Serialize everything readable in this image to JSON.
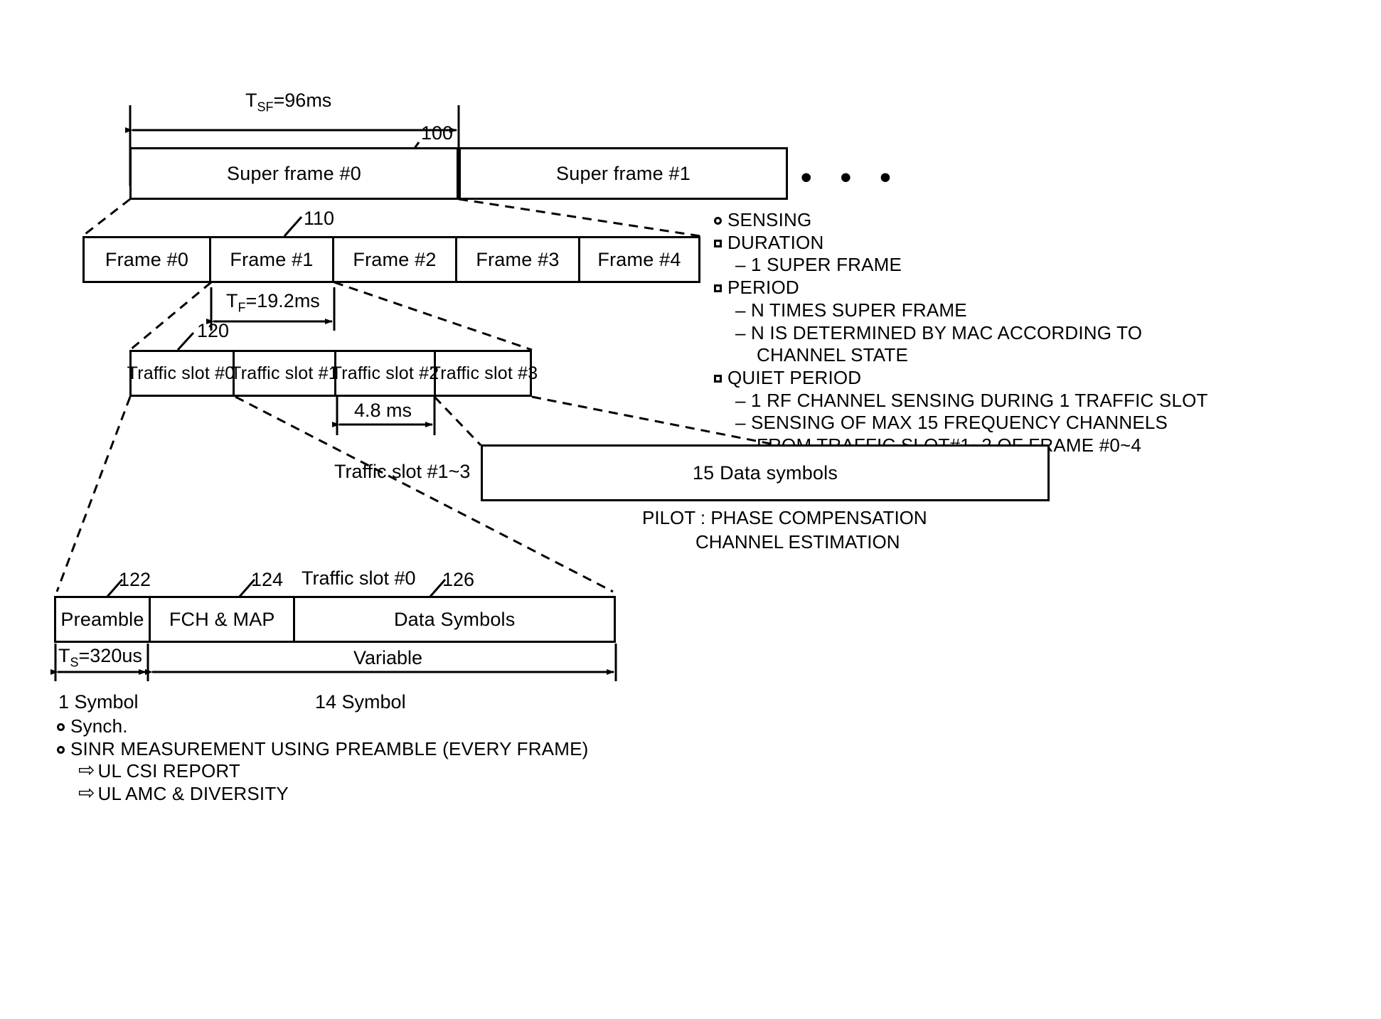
{
  "diagram": {
    "superframe": {
      "duration_label": "T_SF=96ms",
      "duration_main": "T",
      "duration_sub": "SF",
      "duration_rest": "=96ms",
      "ref": "100",
      "blocks": [
        "Super frame #0",
        "Super frame #1"
      ],
      "continuation": "• • •"
    },
    "frames": {
      "ref": "110",
      "blocks": [
        "Frame #0",
        "Frame #1",
        "Frame #2",
        "Frame #3",
        "Frame #4"
      ],
      "duration_main": "T",
      "duration_sub": "F",
      "duration_rest": "=19.2ms"
    },
    "traffic_slots": {
      "ref": "120",
      "blocks": [
        "Traffic slot #0",
        "Traffic slot #1",
        "Traffic slot #2",
        "Traffic slot #3"
      ],
      "slot_duration": "4.8 ms",
      "callout_label": "Traffic slot #1~3",
      "data_symbols_box": "15 Data symbols"
    },
    "pilot_note": {
      "line1": "PILOT : PHASE COMPENSATION",
      "line2": "CHANNEL ESTIMATION"
    },
    "slot0_detail": {
      "title": "Traffic slot #0",
      "refs": [
        "122",
        "124",
        "126"
      ],
      "blocks": [
        "Preamble",
        "FCH & MAP",
        "Data Symbols"
      ],
      "ts_main": "T",
      "ts_sub": "S",
      "ts_rest": "=320us",
      "variable_label": "Variable",
      "symbol_left": "1 Symbol",
      "symbol_right": "14 Symbol"
    }
  },
  "sensing_notes": {
    "heading": "SENSING",
    "items": [
      {
        "marker": "square",
        "level": 0,
        "text": "DURATION"
      },
      {
        "marker": "dash",
        "level": 1,
        "text": "1 SUPER FRAME"
      },
      {
        "marker": "square",
        "level": 0,
        "text": "PERIOD"
      },
      {
        "marker": "dash",
        "level": 1,
        "text": "N TIMES SUPER FRAME"
      },
      {
        "marker": "dash",
        "level": 1,
        "text": "N IS DETERMINED BY MAC ACCORDING TO"
      },
      {
        "marker": "none",
        "level": 2,
        "text": "CHANNEL STATE"
      },
      {
        "marker": "square",
        "level": 0,
        "text": "QUIET PERIOD"
      },
      {
        "marker": "dash",
        "level": 1,
        "text": "1 RF CHANNEL SENSING DURING 1 TRAFFIC SLOT"
      },
      {
        "marker": "dash",
        "level": 1,
        "text": "SENSING OF MAX 15 FREQUENCY CHANNELS"
      },
      {
        "marker": "none",
        "level": 2,
        "text": "FROM TRAFFIC SLOT#1~2 OF FRAME #0~4"
      }
    ]
  },
  "preamble_notes": {
    "items": [
      {
        "marker": "circle",
        "text": "Synch."
      },
      {
        "marker": "circle",
        "text": "SINR MEASUREMENT USING PREAMBLE (EVERY FRAME)"
      },
      {
        "marker": "arrow",
        "text": "UL CSI REPORT"
      },
      {
        "marker": "arrow",
        "text": "UL AMC & DIVERSITY"
      }
    ],
    "arrow_glyph": "⇨"
  }
}
